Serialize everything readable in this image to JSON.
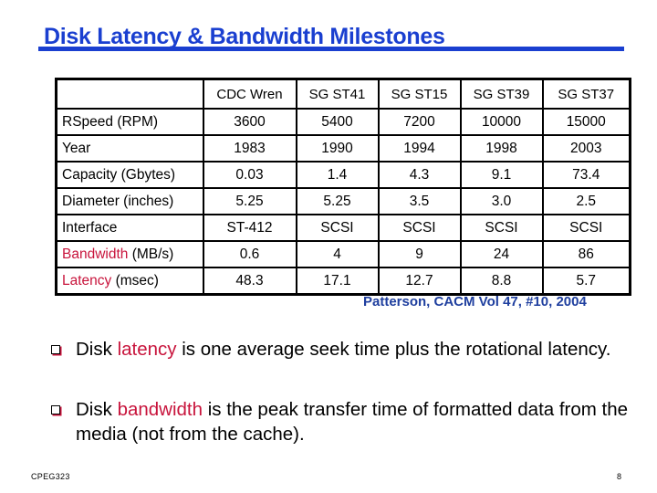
{
  "slide": {
    "title": "Disk Latency & Bandwidth Milestones",
    "accent_color": "#1a3fd0",
    "highlight_color": "#c8143c",
    "citation_color": "#1f3f9f"
  },
  "table": {
    "columns": [
      "",
      "CDC Wren",
      "SG ST41",
      "SG ST15",
      "SG ST39",
      "SG ST37"
    ],
    "rows": [
      {
        "label": "RSpeed (RPM)",
        "label_highlight": "",
        "label_rest": "RSpeed (RPM)",
        "values": [
          "3600",
          "5400",
          "7200",
          "10000",
          "15000"
        ]
      },
      {
        "label": "Year",
        "label_highlight": "",
        "label_rest": "Year",
        "values": [
          "1983",
          "1990",
          "1994",
          "1998",
          "2003"
        ]
      },
      {
        "label": "Capacity (Gbytes)",
        "label_highlight": "",
        "label_rest": "Capacity (Gbytes)",
        "values": [
          "0.03",
          "1.4",
          "4.3",
          "9.1",
          "73.4"
        ]
      },
      {
        "label": "Diameter (inches)",
        "label_highlight": "",
        "label_rest": "Diameter (inches)",
        "values": [
          "5.25",
          "5.25",
          "3.5",
          "3.0",
          "2.5"
        ]
      },
      {
        "label": "Interface",
        "label_highlight": "",
        "label_rest": "Interface",
        "values": [
          "ST-412",
          "SCSI",
          "SCSI",
          "SCSI",
          "SCSI"
        ]
      },
      {
        "label": "Bandwidth (MB/s)",
        "label_highlight": "Bandwidth",
        "label_rest": " (MB/s)",
        "values": [
          "0.6",
          "4",
          "9",
          "24",
          "86"
        ]
      },
      {
        "label": "Latency (msec)",
        "label_highlight": "Latency",
        "label_rest": " (msec)",
        "values": [
          "48.3",
          "17.1",
          "12.7",
          "8.8",
          "5.7"
        ]
      }
    ]
  },
  "citation": "Patterson, CACM Vol 47, #10, 2004",
  "bullets": [
    {
      "icon": "hollow-square-bullet-icon",
      "pre": "Disk ",
      "highlight": "latency",
      "post": " is one average seek time plus the rotational latency."
    },
    {
      "icon": "hollow-square-bullet-icon",
      "pre": "Disk ",
      "highlight": "bandwidth",
      "post": " is the peak transfer time of formatted data from the media (not from the cache)."
    }
  ],
  "footer": {
    "course": "CPEG323",
    "page_number": "8"
  }
}
